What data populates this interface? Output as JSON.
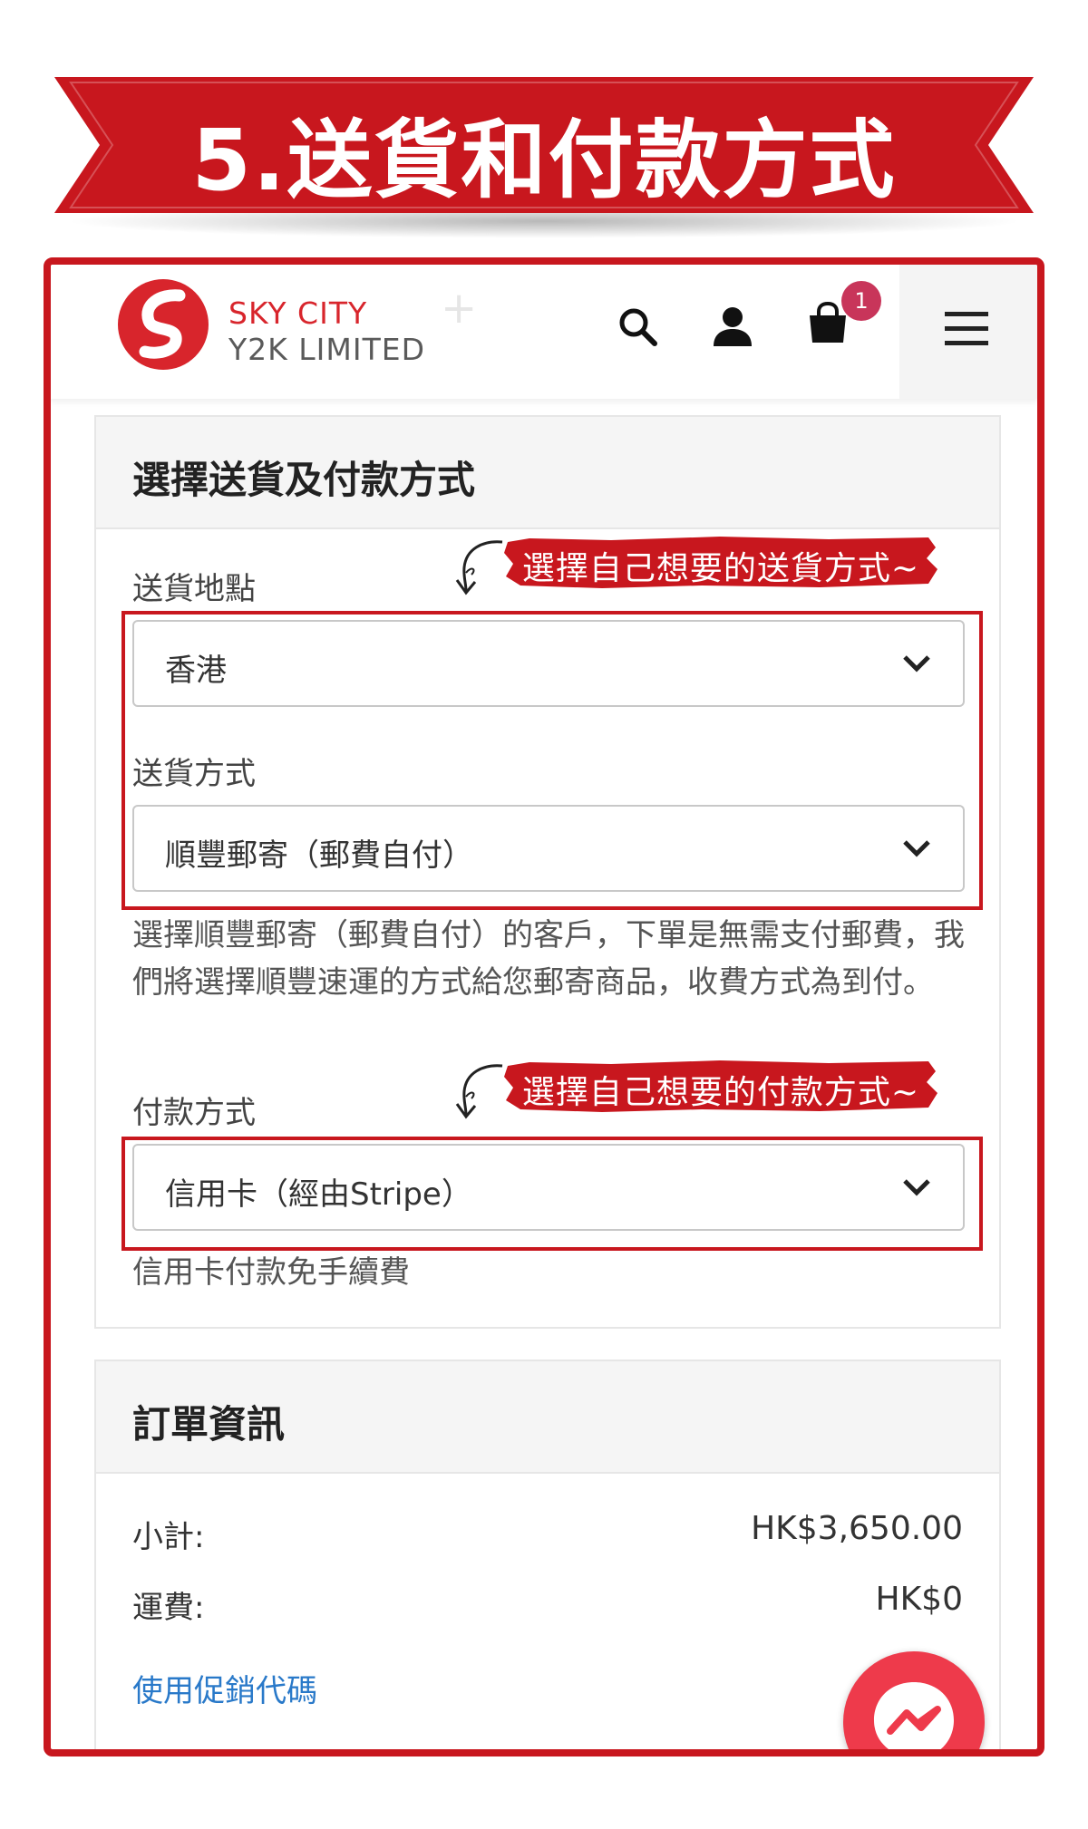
{
  "banner": {
    "title": "5.送貨和付款方式"
  },
  "header": {
    "brand_line1": "SKY CITY",
    "brand_line2": "Y2K LIMITED",
    "cart_count": "1",
    "icons": [
      "search-icon",
      "user-icon",
      "shopping-bag-icon",
      "hamburger-menu-icon"
    ]
  },
  "shipping_card": {
    "title": "選擇送貨及付款方式",
    "location": {
      "label": "送貨地點",
      "value": "香港"
    },
    "method": {
      "label": "送貨方式",
      "value": "順豐郵寄（郵費自付）"
    },
    "method_help": "選擇順豐郵寄（郵費自付）的客戶，下單是無需支付郵費，我們將選擇順豐速運的方式給您郵寄商品，收費方式為到付。",
    "payment": {
      "label": "付款方式",
      "value": "信用卡（經由Stripe）"
    },
    "payment_help": "信用卡付款免手續費"
  },
  "annotations": {
    "shipping_note": "選擇自己想要的送貨方式~",
    "payment_note": "選擇自己想要的付款方式~"
  },
  "order_card": {
    "title": "訂單資訊",
    "subtotal_label": "小計:",
    "subtotal_value": "HK$3,650.00",
    "shipping_label": "運費:",
    "shipping_value": "HK$0",
    "promo_link": "使用促銷代碼"
  },
  "colors": {
    "accent_red": "#c8171e",
    "badge": "#c8355a",
    "link_blue": "#2979c9",
    "messenger_red": "#ee3a4b"
  }
}
